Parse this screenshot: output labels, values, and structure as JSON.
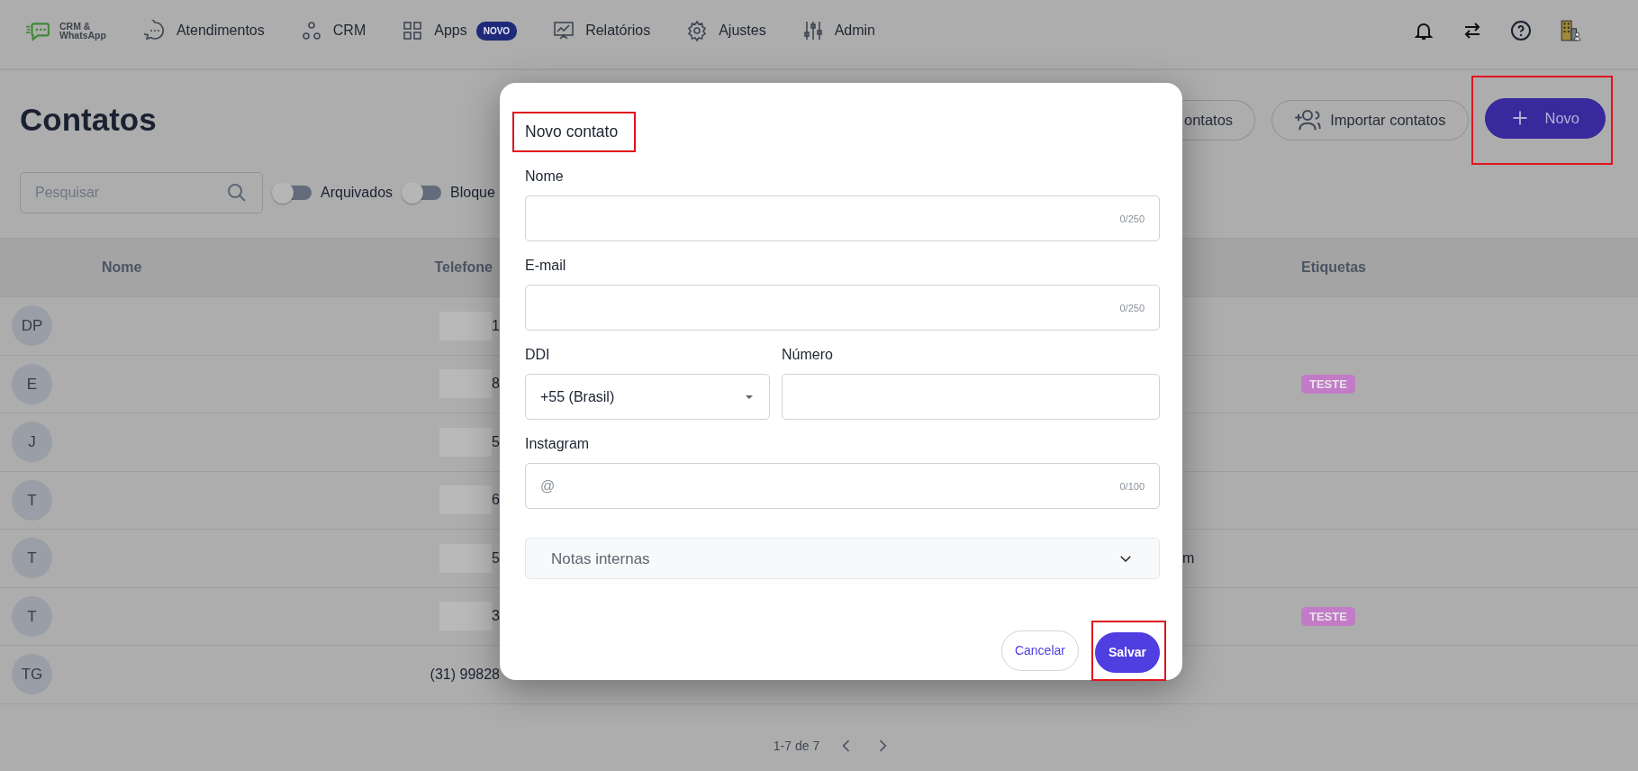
{
  "nav": {
    "logo_lines": [
      "CRM &",
      "WhatsApp"
    ],
    "items": [
      {
        "label": "Atendimentos"
      },
      {
        "label": "CRM"
      },
      {
        "label": "Apps",
        "badge": "NOVO"
      },
      {
        "label": "Relatórios"
      },
      {
        "label": "Ajustes"
      },
      {
        "label": "Admin"
      }
    ]
  },
  "page": {
    "title": "Contatos",
    "buttons": [
      {
        "label": "ontatos",
        "kind": "cut",
        "highlighted": false
      },
      {
        "label": "Importar contatos",
        "kind": "import",
        "highlighted": false
      },
      {
        "label": "Novo",
        "kind": "primary",
        "highlighted": true
      }
    ],
    "search": {
      "placeholder": "Pesquisar"
    },
    "filters": [
      {
        "label": "Arquivados",
        "on": false
      },
      {
        "label": "Bloque",
        "on": false
      }
    ]
  },
  "table": {
    "columns": [
      "Nome",
      "Telefone",
      "Etiquetas"
    ],
    "rows": [
      {
        "initials": "DP",
        "phone": "1",
        "redacted": true
      },
      {
        "initials": "E",
        "phone": "8",
        "redacted": true,
        "tags": [
          {
            "label": "TESTE",
            "color": "#c27bc6"
          }
        ]
      },
      {
        "initials": "J",
        "phone": "5",
        "redacted": true
      },
      {
        "initials": "T",
        "phone": "6",
        "redacted": true
      },
      {
        "initials": "T",
        "phone": "5",
        "redacted": true,
        "column_3": "m"
      },
      {
        "initials": "T",
        "phone": "3",
        "redacted": true,
        "tags": [
          {
            "label": "TESTE",
            "color": "#c27bc6"
          }
        ]
      },
      {
        "initials": "TG",
        "phone": "(31) 99828",
        "redacted": false
      }
    ]
  },
  "pagination": {
    "range": "1-7 de 7"
  },
  "modal": {
    "title": "Novo contato",
    "title_highlighted": true,
    "field_rows": [
      {
        "fields": [
          {
            "label": "Nome",
            "kind": "text",
            "counter": "0/250"
          }
        ]
      },
      {
        "fields": [
          {
            "label": "E-mail",
            "kind": "text",
            "counter": "0/250"
          }
        ]
      },
      {
        "fields": [
          {
            "label": "DDI",
            "kind": "select",
            "value": "+55 (Brasil)"
          },
          {
            "label": "Número",
            "kind": "text"
          }
        ]
      },
      {
        "fields": [
          {
            "label": "Instagram",
            "kind": "text",
            "placeholder": "@",
            "counter": "0/100"
          }
        ]
      }
    ],
    "notes": {
      "label": "Notas internas",
      "expanded": false
    },
    "buttons": [
      {
        "label": "Cancelar",
        "kind": "outline",
        "highlighted": false
      },
      {
        "label": "Salvar",
        "kind": "primary",
        "highlighted": true
      }
    ]
  }
}
